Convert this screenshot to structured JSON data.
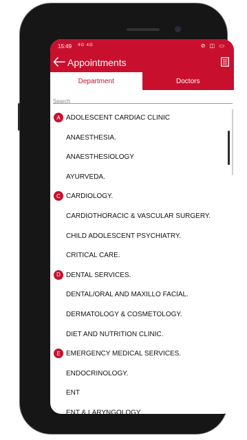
{
  "status_bar": {
    "time": "15:49",
    "signal_text": "4G 4G",
    "right_icons": "⊘ ◫ ▭"
  },
  "app_bar": {
    "title": "Appointments",
    "back_icon": "arrow-left",
    "menu_icon": "list"
  },
  "tabs": [
    {
      "label": "Department",
      "active": true
    },
    {
      "label": "Doctors",
      "active": false
    }
  ],
  "search": {
    "placeholder": "Search",
    "value": ""
  },
  "departments": [
    {
      "letter": "A",
      "label": "ADOLESCENT CARDIAC CLINIC"
    },
    {
      "letter": "",
      "label": "ANAESTHESIA."
    },
    {
      "letter": "",
      "label": "ANAESTHESIOLOGY"
    },
    {
      "letter": "",
      "label": "AYURVEDA."
    },
    {
      "letter": "C",
      "label": "CARDIOLOGY."
    },
    {
      "letter": "",
      "label": "CARDIOTHORACIC & VASCULAR SURGERY."
    },
    {
      "letter": "",
      "label": "CHILD ADOLESCENT PSYCHIATRY."
    },
    {
      "letter": "",
      "label": "CRITICAL CARE."
    },
    {
      "letter": "D",
      "label": "DENTAL SERVICES."
    },
    {
      "letter": "",
      "label": "DENTAL/ORAL AND MAXILLO FACIAL."
    },
    {
      "letter": "",
      "label": "DERMATOLOGY & COSMETOLOGY."
    },
    {
      "letter": "",
      "label": "DIET AND NUTRITION CLINIC."
    },
    {
      "letter": "E",
      "label": "EMERGENCY MEDICAL SERVICES."
    },
    {
      "letter": "",
      "label": "ENDOCRINOLOGY."
    },
    {
      "letter": "",
      "label": "ENT"
    },
    {
      "letter": "",
      "label": "ENT & LARYNGOLOGY"
    }
  ],
  "colors": {
    "accent": "#c8102e",
    "text": "#111111"
  }
}
